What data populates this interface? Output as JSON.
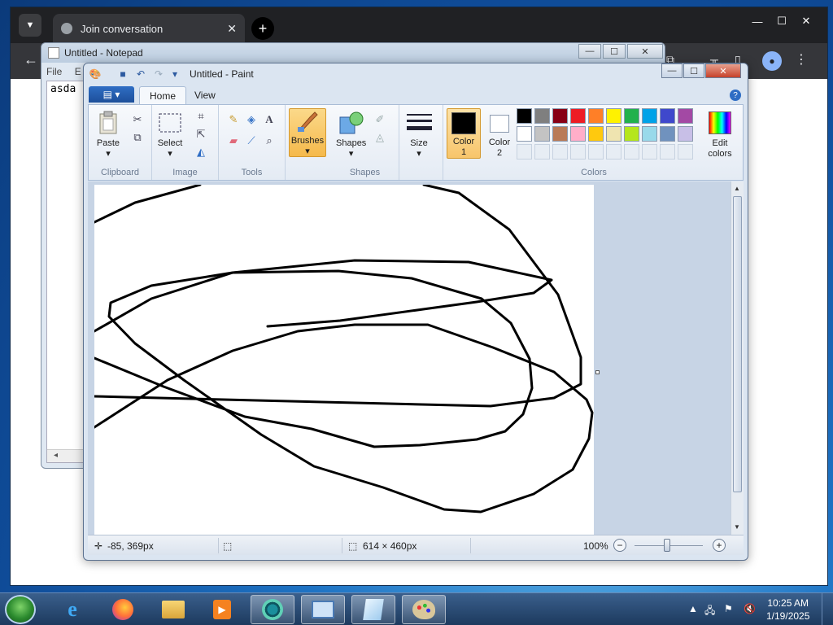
{
  "chrome": {
    "tab_title": "Join conversation",
    "tab_close": "✕",
    "new_tab": "+",
    "back": "←",
    "minimize": "—",
    "maximize": "☐",
    "close": "✕"
  },
  "notepad": {
    "title": "Untitled - Notepad",
    "menu": [
      "File",
      "E"
    ],
    "text": "asda",
    "scroll_left": "◂"
  },
  "paint": {
    "title": "Untitled - Paint",
    "tabs": {
      "file": "▤ ▾",
      "home": "Home",
      "view": "View"
    },
    "help": "?",
    "groups": {
      "clipboard": {
        "label": "Clipboard",
        "paste": "Paste"
      },
      "image": {
        "label": "Image",
        "select": "Select"
      },
      "tools": {
        "label": "Tools"
      },
      "brushes": {
        "label": "Brushes"
      },
      "shapes": {
        "label": "Shapes",
        "button": "Shapes"
      },
      "size": {
        "label": "Size"
      },
      "colors": {
        "label": "Colors",
        "color1_line1": "Color",
        "color1_line2": "1",
        "color2_line1": "Color",
        "color2_line2": "2",
        "edit_line1": "Edit",
        "edit_line2": "colors"
      }
    },
    "palette_row1": [
      "#000000",
      "#7f7f7f",
      "#880015",
      "#ed1c24",
      "#ff7f27",
      "#fff200",
      "#22b14c",
      "#00a2e8",
      "#3f48cc",
      "#a349a4"
    ],
    "palette_row2": [
      "#ffffff",
      "#c3c3c3",
      "#b97a57",
      "#ffaec9",
      "#ffc90e",
      "#efe4b0",
      "#b5e61d",
      "#99d9ea",
      "#7092be",
      "#c8bfe7"
    ],
    "color1": "#000000",
    "color2": "#ffffff",
    "status": {
      "cursor_pos": "-85, 369px",
      "canvas_size": "614 × 460px",
      "zoom": "100%",
      "zoom_out": "−",
      "zoom_in": "+"
    }
  },
  "taskbar": {
    "time": "10:25 AM",
    "date": "1/19/2025"
  }
}
